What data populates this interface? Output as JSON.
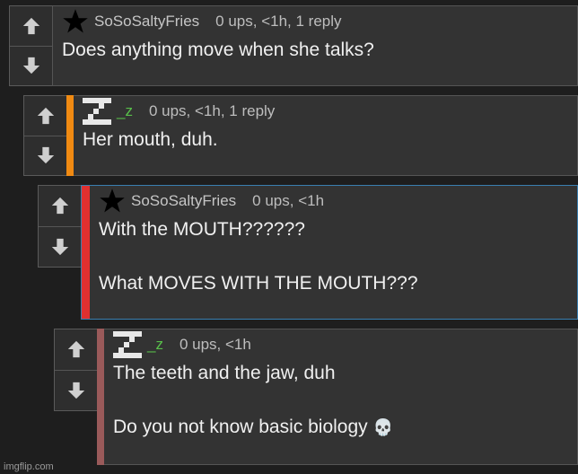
{
  "comments": [
    {
      "username": "SoSoSaltyFries",
      "avatar": "star-icon",
      "meta": "0 ups, <1h, 1 reply",
      "text": "Does anything move when she talks?"
    },
    {
      "username": "_z",
      "avatar": "z-pixel-icon",
      "meta": "0 ups, <1h, 1 reply",
      "text": "Her mouth, duh."
    },
    {
      "username": "SoSoSaltyFries",
      "avatar": "star-icon",
      "meta": "0 ups, <1h",
      "text": "With the MOUTH??????\n\nWhat MOVES WITH THE MOUTH???"
    },
    {
      "username": "_z",
      "avatar": "z-pixel-icon",
      "meta": "0 ups, <1h",
      "text": "The teeth and the jaw, duh\n\nDo you not know basic biology",
      "emoji": "💀"
    }
  ],
  "colors": {
    "accent_orange": "#f08a12",
    "accent_red": "#e03030",
    "accent_brown": "#9a5a5a",
    "selected_border": "#3a7fb0"
  },
  "watermark": "imgflip.com"
}
